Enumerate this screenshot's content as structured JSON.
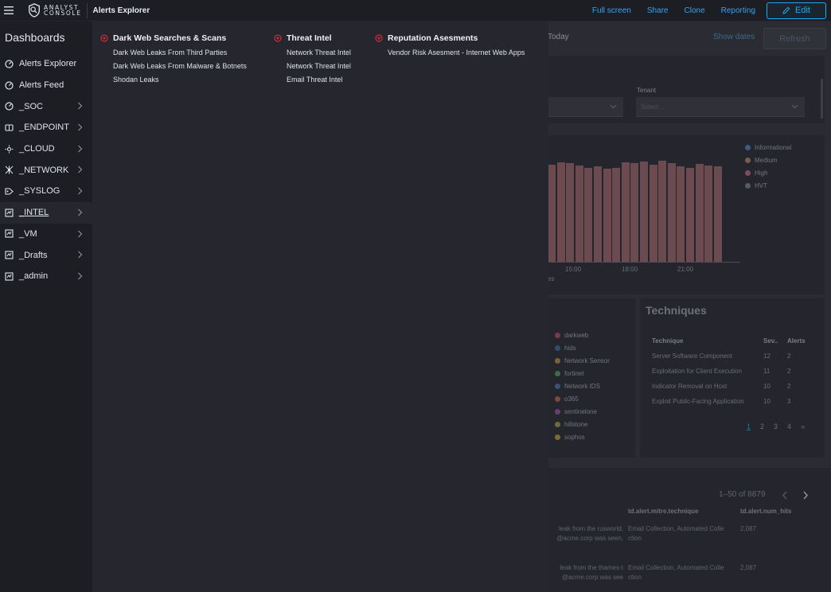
{
  "app": {
    "logo_line1": "ANALYST",
    "logo_line2": "CONSOLE",
    "page_title": "Alerts Explorer"
  },
  "top_actions": {
    "full_screen": "Full screen",
    "share": "Share",
    "clone": "Clone",
    "reporting": "Reporting",
    "edit": "Edit"
  },
  "sidenav": {
    "heading": "Dashboards",
    "items": [
      {
        "label": "Alerts Explorer",
        "icon": "dashboard-icon",
        "chevron": false
      },
      {
        "label": "Alerts Feed",
        "icon": "dashboard-icon",
        "chevron": false
      },
      {
        "label": "_SOC",
        "icon": "dashboard-icon",
        "chevron": true
      },
      {
        "label": "_ENDPOINT",
        "icon": "endpoint-icon",
        "chevron": true
      },
      {
        "label": "_CLOUD",
        "icon": "cloud-icon",
        "chevron": true
      },
      {
        "label": "_NETWORK",
        "icon": "network-icon",
        "chevron": true
      },
      {
        "label": "_SYSLOG",
        "icon": "syslog-icon",
        "chevron": true
      },
      {
        "label": "_INTEL",
        "icon": "intel-icon",
        "chevron": true,
        "active": true
      },
      {
        "label": "_VM",
        "icon": "intel-icon",
        "chevron": true
      },
      {
        "label": "_Drafts",
        "icon": "intel-icon",
        "chevron": true
      },
      {
        "label": "_admin",
        "icon": "intel-icon",
        "chevron": true
      }
    ]
  },
  "flyout": {
    "columns": [
      {
        "title": "Dark Web Searches & Scans",
        "items": [
          "Dark Web Leaks From Third Parties",
          "Dark Web Leaks From Malware & Botnets",
          "Shodan Leaks"
        ]
      },
      {
        "title": "Threat Intel",
        "items": [
          "Network Threat Intel",
          "Network Threat Intel",
          "Email Threat Intel"
        ]
      },
      {
        "title": "Reputation Asesments",
        "items": [
          "Vendor Risk Asesment - Internet Web Apps"
        ]
      }
    ]
  },
  "background": {
    "today": "Today",
    "show_dates": "Show dates",
    "refresh": "Refresh",
    "tenant_label": "Tenant",
    "tenant_placeholder": "Select...",
    "legend": [
      "Informational",
      "Medium",
      "High",
      "HVT"
    ],
    "legend_colors": [
      "#3d5a80",
      "#7a5d4a",
      "#7a4f57",
      "#565a66"
    ],
    "x_ticks": [
      "15:00",
      "18:00",
      "21:00"
    ],
    "x_axis_fragment": "es",
    "source_legend": [
      "darkweb",
      "hids",
      "Network Sensor",
      "fortinet",
      "Network IDS",
      "o365",
      "sentinelone",
      "hillstone",
      "sophos"
    ],
    "source_colors": [
      "#7a3a4e",
      "#2f4d6e",
      "#7a6040",
      "#3a6e4a",
      "#3a4f7a",
      "#7a4a3e",
      "#6a3e78",
      "#6e6a3a",
      "#7a6a3a"
    ],
    "techniques_title": "Techniques",
    "techniques_headers": [
      "Technique",
      "Sev..",
      "Alerts"
    ],
    "techniques_rows": [
      [
        "Server Software Component",
        "12",
        "2"
      ],
      [
        "Exploitation for Client Execution",
        "11",
        "2"
      ],
      [
        "Indicator Removal on Host",
        "10",
        "2"
      ],
      [
        "Exploit Public-Facing Application",
        "10",
        "3"
      ]
    ],
    "pager": [
      "1",
      "2",
      "3",
      "4",
      "»"
    ],
    "table_count": "1–50 of 8879",
    "table_headers": [
      "td.alert.mitre.technique",
      "td.alert.num_hits"
    ],
    "table_rows": [
      {
        "frag": "leak from the rusworld.\n@acme.corp was seen,",
        "technique": "Email Collection, Automated Colle\nction",
        "hits": "2,087"
      },
      {
        "frag": "leak from the thames-t\n@acme.corp was see",
        "technique": "Email Collection, Automated Colle\nction",
        "hits": "2,087"
      }
    ]
  }
}
